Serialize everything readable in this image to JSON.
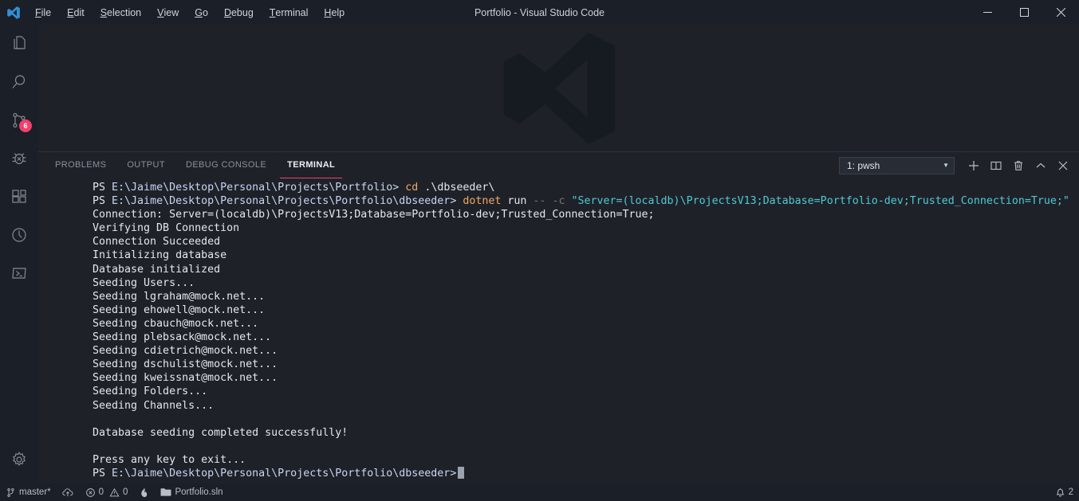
{
  "window": {
    "title": "Portfolio - Visual Studio Code",
    "logo_icon": "vscode-logo-icon",
    "controls": [
      {
        "name": "minimize-button",
        "icon": "minimize-icon"
      },
      {
        "name": "maximize-button",
        "icon": "maximize-icon"
      },
      {
        "name": "close-button",
        "icon": "close-icon"
      }
    ]
  },
  "menubar": {
    "items": [
      {
        "label": "File",
        "mnemonic": "F"
      },
      {
        "label": "Edit",
        "mnemonic": "E"
      },
      {
        "label": "Selection",
        "mnemonic": "S"
      },
      {
        "label": "View",
        "mnemonic": "V"
      },
      {
        "label": "Go",
        "mnemonic": "G"
      },
      {
        "label": "Debug",
        "mnemonic": "D"
      },
      {
        "label": "Terminal",
        "mnemonic": "T"
      },
      {
        "label": "Help",
        "mnemonic": "H"
      }
    ]
  },
  "activitybar": {
    "items": [
      {
        "name": "explorer",
        "icon": "files-icon",
        "badge": ""
      },
      {
        "name": "search",
        "icon": "search-icon",
        "badge": ""
      },
      {
        "name": "source-control",
        "icon": "source-control-icon",
        "badge": "6"
      },
      {
        "name": "debug",
        "icon": "debug-icon",
        "badge": ""
      },
      {
        "name": "extensions",
        "icon": "extensions-icon",
        "badge": ""
      },
      {
        "name": "test-explorer",
        "icon": "clock-circle-icon",
        "badge": ""
      },
      {
        "name": "powershell",
        "icon": "terminal-panel-icon",
        "badge": ""
      }
    ],
    "bottom": [
      {
        "name": "manage-settings",
        "icon": "gear-icon",
        "badge": ""
      }
    ]
  },
  "panel": {
    "tabs": [
      {
        "label": "PROBLEMS",
        "active": false
      },
      {
        "label": "OUTPUT",
        "active": false
      },
      {
        "label": "DEBUG CONSOLE",
        "active": false
      },
      {
        "label": "TERMINAL",
        "active": true
      }
    ],
    "active_tab_underline_color": "#f1416c",
    "terminal_select": {
      "value": "1: pwsh",
      "caret_icon": "chevron-down-icon"
    },
    "actions": [
      {
        "name": "new-terminal-button",
        "icon": "plus-icon"
      },
      {
        "name": "split-terminal-button",
        "icon": "split-icon"
      },
      {
        "name": "kill-terminal-button",
        "icon": "trash-icon"
      },
      {
        "name": "maximize-panel-button",
        "icon": "chevron-up-icon"
      },
      {
        "name": "close-panel-button",
        "icon": "close-icon"
      }
    ]
  },
  "terminal": {
    "lines": [
      {
        "segments": [
          {
            "text": "PS ",
            "cls": "c-white"
          },
          {
            "text": "E:\\Jaime\\Desktop\\Personal\\Projects\\Portfolio>",
            "cls": "c-path"
          },
          {
            "text": " cd",
            "cls": "c-cmd"
          },
          {
            "text": " .\\dbseeder\\",
            "cls": "c-arg"
          }
        ]
      },
      {
        "segments": [
          {
            "text": "PS ",
            "cls": "c-white"
          },
          {
            "text": "E:\\Jaime\\Desktop\\Personal\\Projects\\Portfolio\\dbseeder>",
            "cls": "c-path"
          },
          {
            "text": " dotnet",
            "cls": "c-cmd"
          },
          {
            "text": " run",
            "cls": "c-arg"
          },
          {
            "text": " --",
            "cls": "c-dim"
          },
          {
            "text": " -c",
            "cls": "c-dim"
          },
          {
            "text": " \"Server=(localdb)\\ProjectsV13;Database=Portfolio-dev;Trusted_Connection=True;\"",
            "cls": "c-str"
          }
        ]
      },
      {
        "segments": [
          {
            "text": "Connection: Server=(localdb)\\ProjectsV13;Database=Portfolio-dev;Trusted_Connection=True;",
            "cls": "c-white"
          }
        ]
      },
      {
        "segments": [
          {
            "text": "Verifying DB Connection",
            "cls": "c-white"
          }
        ]
      },
      {
        "segments": [
          {
            "text": "Connection Succeeded",
            "cls": "c-white"
          }
        ]
      },
      {
        "segments": [
          {
            "text": "Initializing database",
            "cls": "c-white"
          }
        ]
      },
      {
        "segments": [
          {
            "text": "Database initialized",
            "cls": "c-white"
          }
        ]
      },
      {
        "segments": [
          {
            "text": "Seeding Users...",
            "cls": "c-white"
          }
        ]
      },
      {
        "segments": [
          {
            "text": "Seeding lgraham@mock.net...",
            "cls": "c-white"
          }
        ]
      },
      {
        "segments": [
          {
            "text": "Seeding ehowell@mock.net...",
            "cls": "c-white"
          }
        ]
      },
      {
        "segments": [
          {
            "text": "Seeding cbauch@mock.net...",
            "cls": "c-white"
          }
        ]
      },
      {
        "segments": [
          {
            "text": "Seeding plebsack@mock.net...",
            "cls": "c-white"
          }
        ]
      },
      {
        "segments": [
          {
            "text": "Seeding cdietrich@mock.net...",
            "cls": "c-white"
          }
        ]
      },
      {
        "segments": [
          {
            "text": "Seeding dschulist@mock.net...",
            "cls": "c-white"
          }
        ]
      },
      {
        "segments": [
          {
            "text": "Seeding kweissnat@mock.net...",
            "cls": "c-white"
          }
        ]
      },
      {
        "segments": [
          {
            "text": "Seeding Folders...",
            "cls": "c-white"
          }
        ]
      },
      {
        "segments": [
          {
            "text": "Seeding Channels...",
            "cls": "c-white"
          }
        ]
      },
      {
        "segments": [
          {
            "text": "",
            "cls": "c-white"
          }
        ]
      },
      {
        "segments": [
          {
            "text": "Database seeding completed successfully!",
            "cls": "c-white"
          }
        ]
      },
      {
        "segments": [
          {
            "text": "",
            "cls": "c-white"
          }
        ]
      },
      {
        "segments": [
          {
            "text": "Press any key to exit...",
            "cls": "c-white"
          }
        ]
      },
      {
        "segments": [
          {
            "text": "PS ",
            "cls": "c-white"
          },
          {
            "text": "E:\\Jaime\\Desktop\\Personal\\Projects\\Portfolio\\dbseeder>",
            "cls": "c-path"
          }
        ],
        "cursor": true
      }
    ]
  },
  "statusbar": {
    "left": [
      {
        "name": "branch-status",
        "icon": "source-control-branch-icon",
        "label": "master*"
      },
      {
        "name": "sync-status",
        "icon": "sync-cloud-icon",
        "label": ""
      },
      {
        "name": "problems-status",
        "icon": "error-warning-icon",
        "label": "0",
        "label2": "0"
      },
      {
        "name": "flame-status",
        "icon": "flame-icon",
        "label": ""
      },
      {
        "name": "solution-status",
        "icon": "folder-icon",
        "label": "Portfolio.sln"
      }
    ],
    "right": [
      {
        "name": "notifications-status",
        "icon": "bell-icon",
        "label": "2"
      }
    ]
  },
  "colors": {
    "accent": "#f1416c",
    "background": "#1e2228",
    "chrome": "#1b1f27",
    "string": "#4ec9d4",
    "command": "#f0a868",
    "path": "#c9d4f2"
  }
}
